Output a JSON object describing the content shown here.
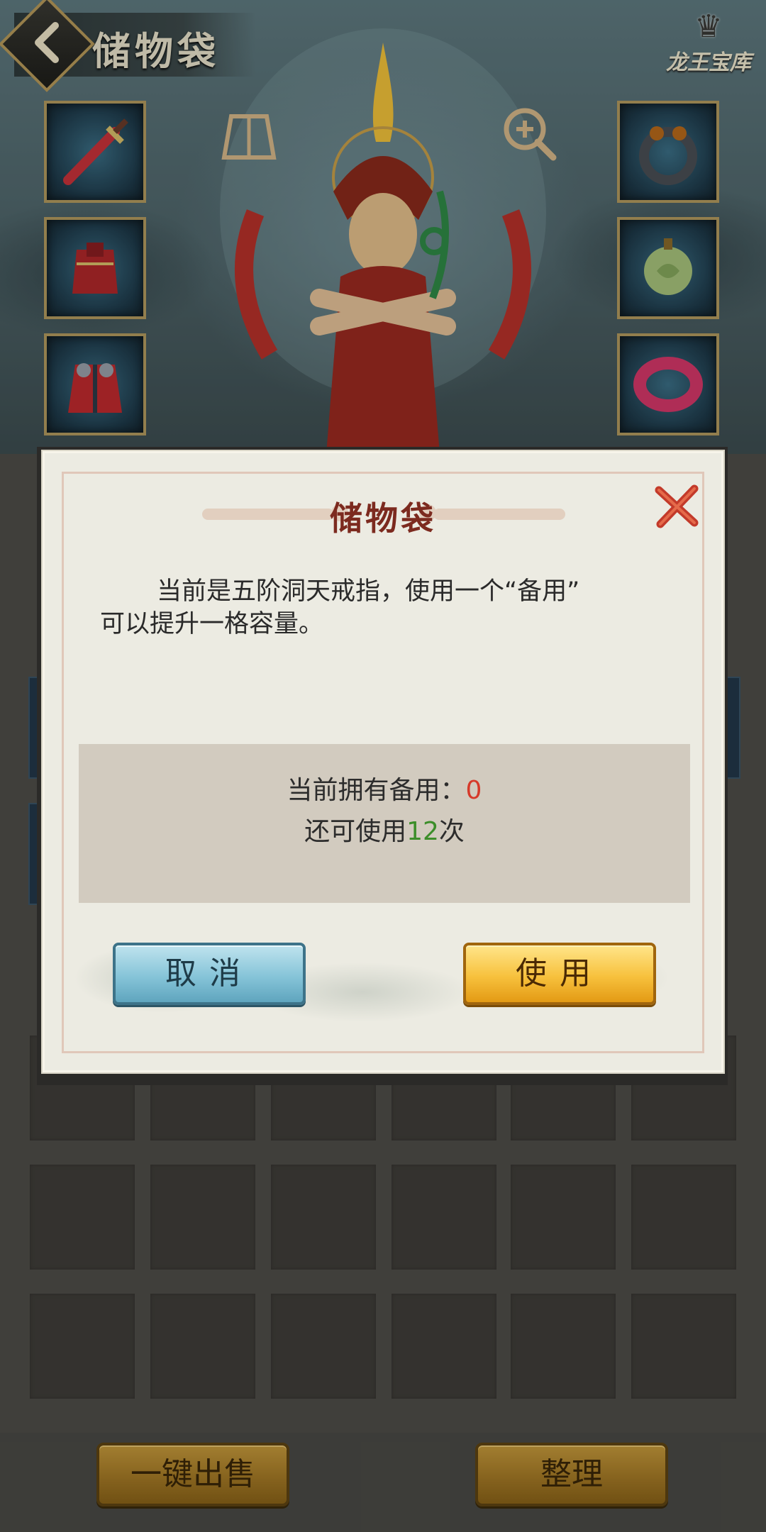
{
  "header": {
    "title": "储物袋",
    "logo_text": "龙王宝库"
  },
  "equipment": {
    "left_slots": [
      "sword-icon",
      "armor-icon",
      "robe-icon"
    ],
    "right_slots": [
      "ring-icon",
      "jade-pendant-icon",
      "bracelet-icon"
    ],
    "top_icons": [
      "outfit-icon",
      "magnify-icon"
    ]
  },
  "dialog": {
    "title": "储物袋",
    "description_line1": "当前是五阶洞天戒指，使用一个“备用”",
    "description_line2": "可以提升一格容量。",
    "owned_label": "当前拥有备用：",
    "owned_value": "0",
    "remaining_prefix": "还可使用",
    "remaining_value": "12",
    "remaining_suffix": "次",
    "cancel_label": "取消",
    "use_label": "使用",
    "colors": {
      "owned_value": "#d63a2a",
      "remaining_value": "#3c8e2a"
    }
  },
  "bottom": {
    "sell_all_label": "一键出售",
    "sort_label": "整理"
  }
}
